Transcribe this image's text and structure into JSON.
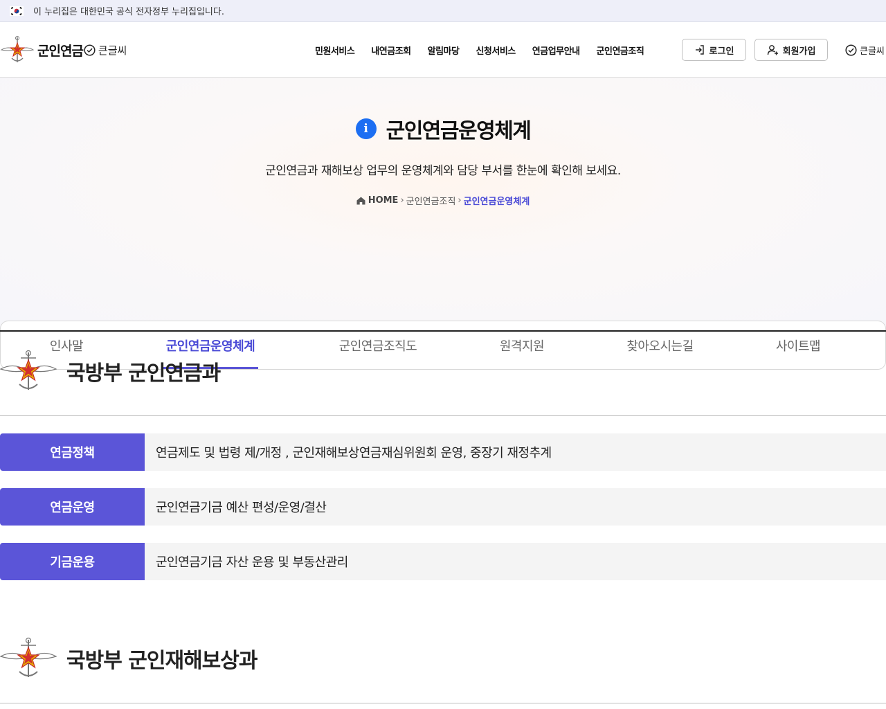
{
  "gov_banner": {
    "text": "이 누리집은 대한민국 공식 전자정부 누리집입니다."
  },
  "header": {
    "logo_name": "군인연금",
    "logo_bigtext": "큰글씨",
    "gnb": [
      "민원서비스",
      "내연금조회",
      "알림마당",
      "신청서비스",
      "연금업무안내",
      "군인연금조직"
    ],
    "login_label": "로그인",
    "join_label": "회원가입",
    "bigtext_label": "큰글씨"
  },
  "hero": {
    "title": "군인연금운영체계",
    "description": "군인연금과 재해보상 업무의 운영체계와 담당 부서를 한눈에 확인해 보세요.",
    "breadcrumb": {
      "home": "HOME",
      "parent": "군인연금조직",
      "current": "군인연금운영체계"
    }
  },
  "tabs": [
    {
      "label": "인사말"
    },
    {
      "label": "군인연금운영체계"
    },
    {
      "label": "군인연금조직도"
    },
    {
      "label": "원격지원"
    },
    {
      "label": "찾아오시는길"
    },
    {
      "label": "사이트맵"
    }
  ],
  "active_tab": "군인연금운영체계",
  "sections": [
    {
      "title": "국방부 군인연금과",
      "rows": [
        {
          "label": "연금정책",
          "text": "연금제도 및 법령 제/개정 , 군인재해보상연금재심위원회 운영, 중장기 재정추계"
        },
        {
          "label": "연금운영",
          "text": "군인연금기금 예산 편성/운영/결산"
        },
        {
          "label": "기금운용",
          "text": "군인연금기금 자산 운용 및 부동산관리"
        }
      ]
    },
    {
      "title": "국방부 군인재해보상과",
      "rows": []
    }
  ],
  "colors": {
    "accent": "#5b55d8",
    "info_blue": "#1c6ef2",
    "active_tab": "#4a4ad6"
  }
}
